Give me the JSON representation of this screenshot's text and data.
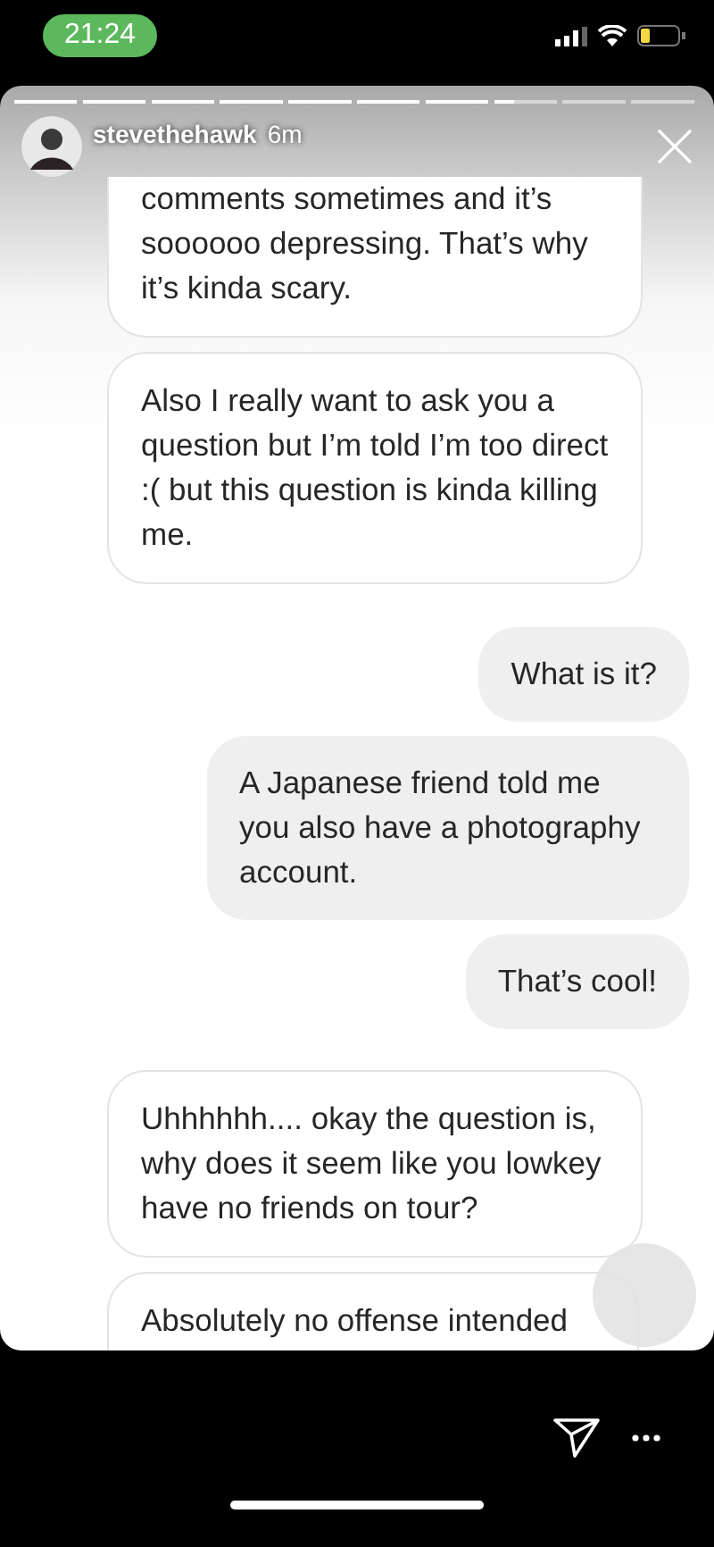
{
  "status_bar": {
    "time": "21:24"
  },
  "story": {
    "progress": {
      "level": 0.73
    },
    "username": "stevethehawk",
    "age": "6m"
  },
  "messages": [
    {
      "kind": "received",
      "clipped_top": true,
      "text": "comments sometimes and it’s soooooo depressing. That’s why it’s kinda scary."
    },
    {
      "kind": "received",
      "text": "Also I really want to ask you a question but I’m told I’m too direct :( but this question is kinda killing me."
    },
    {
      "kind": "gap"
    },
    {
      "kind": "sent",
      "text": "What is it?"
    },
    {
      "kind": "sent",
      "text": "A Japanese friend told me you also have a photography account."
    },
    {
      "kind": "sent",
      "text": "That’s cool!"
    },
    {
      "kind": "gap"
    },
    {
      "kind": "received",
      "text": "Uhhhhhh.... okay the question is, why does it seem like you lowkey have no friends on tour?"
    },
    {
      "kind": "received",
      "clipped_bottom": true,
      "text": "Absolutely no offense intended"
    }
  ]
}
